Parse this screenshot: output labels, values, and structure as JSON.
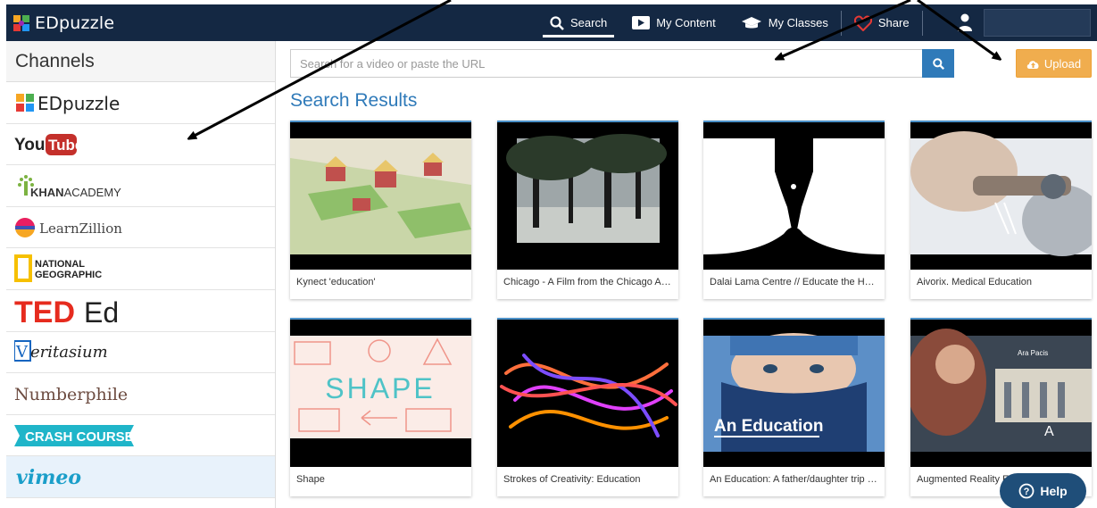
{
  "app": {
    "logo_text": "EDpuzzle"
  },
  "nav": {
    "search": "Search",
    "my_content": "My Content",
    "my_classes": "My Classes",
    "share": "Share"
  },
  "sidebar": {
    "title": "Channels",
    "channels": [
      "EDpuzzle",
      "YouTube",
      "KHAN ACADEMY",
      "LearnZillion",
      "NATIONAL GEOGRAPHIC",
      "TED Ed",
      "Veritasium",
      "Numberphile",
      "CRASH COURSE",
      "vimeo"
    ]
  },
  "search": {
    "placeholder": "Search for a video or paste the URL"
  },
  "upload": {
    "label": "Upload"
  },
  "results": {
    "title": "Search Results",
    "videos": [
      "Kynect 'education'",
      "Chicago - A Film from the Chicago Architecture Foundation",
      "Dalai Lama Centre // Educate the Heart",
      "Aivorix. Medical Education",
      "Shape",
      "Strokes of Creativity: Education",
      "An Education: A father/daughter trip across America",
      "Augmented Reality Education"
    ],
    "thumb_texts": {
      "shape": "SHAPE",
      "education": "An Education",
      "ara": "Ara Pacis"
    }
  },
  "help": {
    "label": "Help"
  },
  "colors": {
    "nav_bg": "#142843",
    "accent": "#2f7ab9",
    "upload": "#f0ad4e",
    "help": "#1f4e79"
  }
}
